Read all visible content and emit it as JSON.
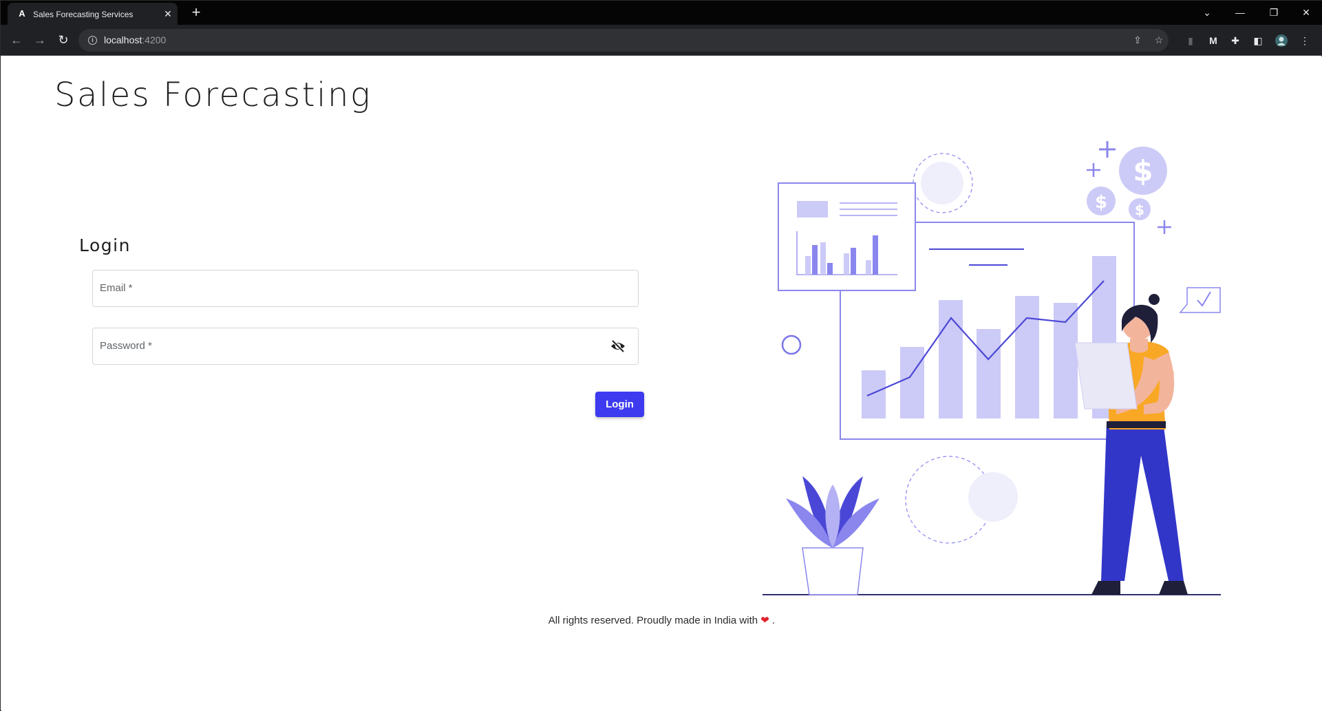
{
  "browser": {
    "tab_title": "Sales Forecasting Services",
    "tab_favicon": "A",
    "url_host": "localhost",
    "url_port": ":4200"
  },
  "app": {
    "title": "Sales Forecasting"
  },
  "login": {
    "heading": "Login",
    "email_label": "Email *",
    "password_label": "Password *",
    "submit_label": "Login"
  },
  "footer": {
    "text": "All rights reserved. Proudly made in India with",
    "heart": "❤",
    "suffix": "."
  },
  "icons": {
    "password_toggle": "visibility-off-icon",
    "illustration": "sales-analytics-illustration"
  },
  "colors": {
    "primary": "#3d3af0",
    "illustration_light": "#cccaf7",
    "illustration_mid": "#8a86ee",
    "person_shirt": "#f9a825",
    "person_pants": "#3236c8"
  }
}
